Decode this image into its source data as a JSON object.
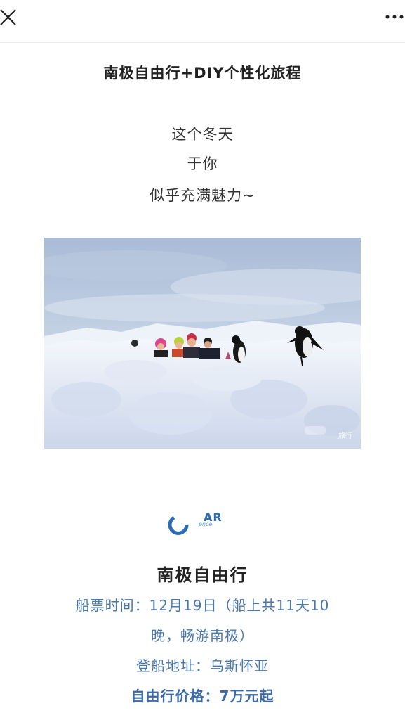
{
  "nav": {
    "close_icon": "close-icon",
    "more_icon": "more-dots-icon"
  },
  "article": {
    "title": "南极自由行+DIY个性化旅程",
    "poem": [
      "这个冬天",
      "于你",
      "似乎充满魅力~"
    ],
    "photo_watermark": "旅行"
  },
  "logo": {
    "text": "AR",
    "subtitle": "ence"
  },
  "section": {
    "title": "南极自由行",
    "ticket_line_1": "船票时间：12月19日（船上共11天10",
    "ticket_line_2": "晚，畅游南极）",
    "boarding": "登船地址：乌斯怀亚",
    "price": "自由行价格：7万元起"
  },
  "colors": {
    "accent_text": "#4a78ad",
    "price_text": "#3a6aa8",
    "logo_blue": "#2d6bb5"
  }
}
